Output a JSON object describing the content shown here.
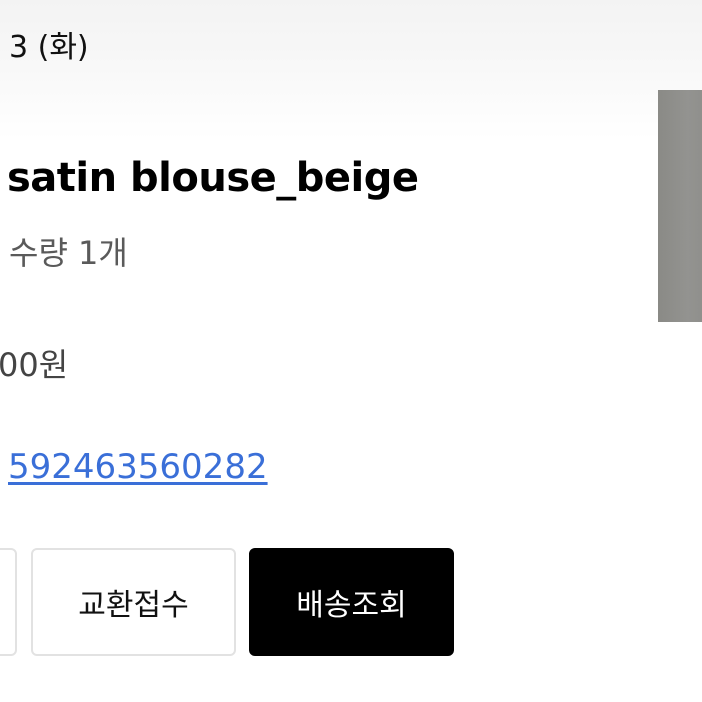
{
  "order": {
    "date_fragment": "3 (화)",
    "product_name": "satin blouse_beige",
    "quantity": "수량 1개",
    "price_fragment": "00원",
    "tracking_number": "592463560282"
  },
  "actions": {
    "exchange_label": "교환접수",
    "tracking_label": "배송조회"
  },
  "colors": {
    "link": "#3a6fd8",
    "primary_button": "#000000",
    "secondary_border": "#e2e2e2"
  }
}
